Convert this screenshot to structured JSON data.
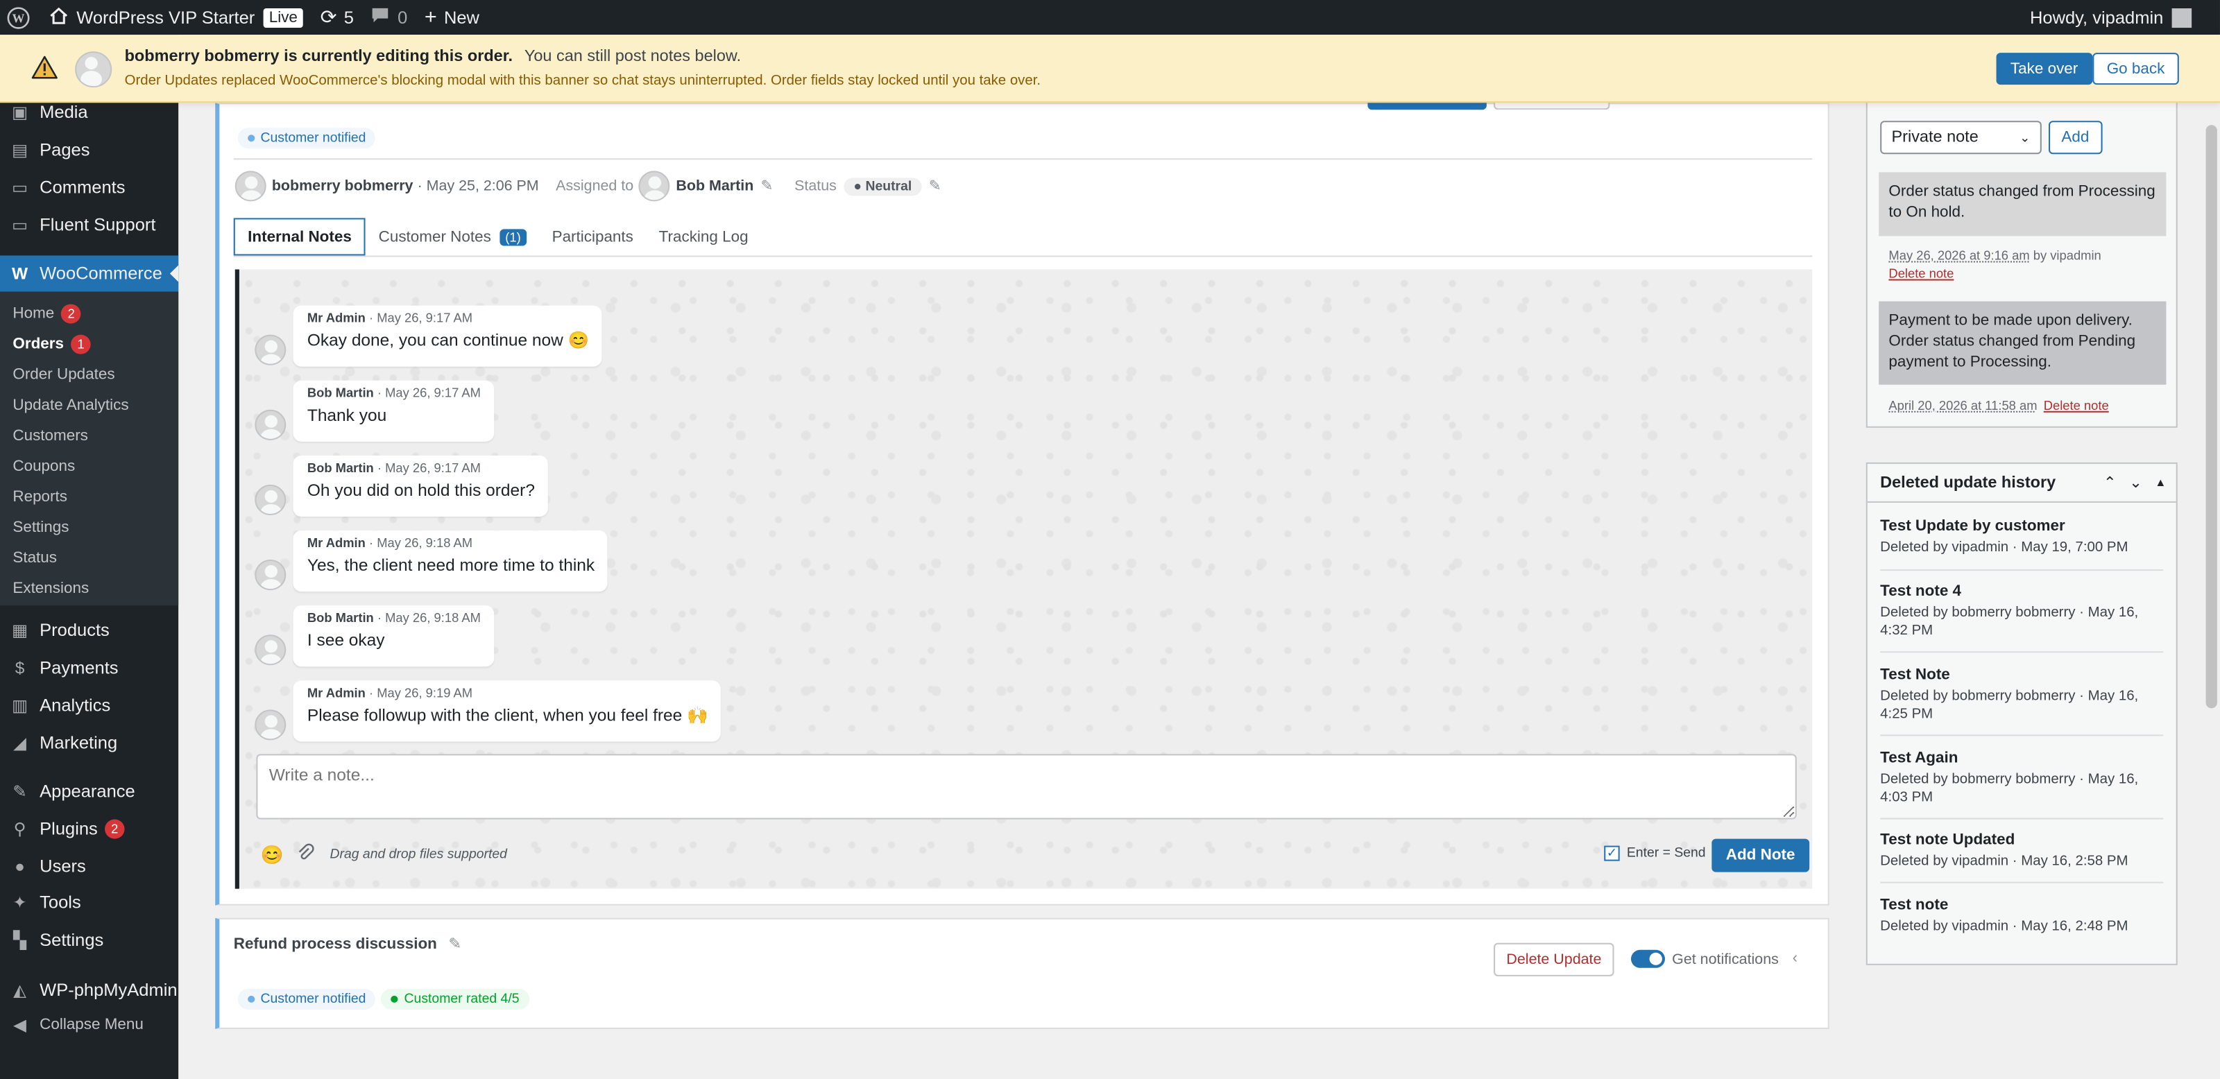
{
  "admin_bar": {
    "site_name": "WordPress VIP Starter",
    "live_label": "Live",
    "updates_count": "5",
    "comments_count": "0",
    "new_label": "New",
    "howdy": "Howdy, vipadmin"
  },
  "banner": {
    "headline": "bobmerry bobmerry is currently editing this order.",
    "headline_extra": "You can still post notes below.",
    "detail": "Order Updates replaced WooCommerce's blocking modal with this banner so chat stays uninterrupted. Order fields stay locked until you take over.",
    "take_over": "Take over",
    "go_back": "Go back"
  },
  "sidebar": {
    "top_items": [
      "Media",
      "Pages",
      "Comments",
      "Fluent Support"
    ],
    "woo_label": "WooCommerce",
    "woo_sub": [
      {
        "label": "Home",
        "count": "2"
      },
      {
        "label": "Orders",
        "count": "1"
      },
      {
        "label": "Order Updates"
      },
      {
        "label": "Update Analytics"
      },
      {
        "label": "Customers"
      },
      {
        "label": "Coupons"
      },
      {
        "label": "Reports"
      },
      {
        "label": "Settings"
      },
      {
        "label": "Status"
      },
      {
        "label": "Extensions"
      }
    ],
    "bottom_items": [
      {
        "label": "Products"
      },
      {
        "label": "Payments"
      },
      {
        "label": "Analytics"
      },
      {
        "label": "Marketing"
      },
      {
        "label": "Appearance"
      },
      {
        "label": "Plugins",
        "count": "2"
      },
      {
        "label": "Users"
      },
      {
        "label": "Tools"
      },
      {
        "label": "Settings"
      },
      {
        "label": "WP-phpMyAdmin"
      },
      {
        "label": "Collapse Menu"
      }
    ]
  },
  "update_card": {
    "customer_notified": "Customer notified",
    "author": "bobmerry bobmerry",
    "date": "· May 25, 2:06 PM",
    "assigned_label": "Assigned to",
    "assignee": "Bob Martin",
    "status_label": "Status",
    "status_value": "Neutral",
    "tabs": [
      {
        "label": "Internal Notes"
      },
      {
        "label": "Customer Notes",
        "count": "(1)"
      },
      {
        "label": "Participants"
      },
      {
        "label": "Tracking Log"
      }
    ],
    "messages": [
      {
        "author": "Mr Admin",
        "time": "· May 26, 9:17 AM",
        "text": "Okay done, you can continue now 😊"
      },
      {
        "author": "Bob Martin",
        "time": "· May 26, 9:17 AM",
        "text": "Thank you"
      },
      {
        "author": "Bob Martin",
        "time": "· May 26, 9:17 AM",
        "text": "Oh you did on hold this order?"
      },
      {
        "author": "Mr Admin",
        "time": "· May 26, 9:18 AM",
        "text": "Yes, the client need more time to think"
      },
      {
        "author": "Bob Martin",
        "time": "· May 26, 9:18 AM",
        "text": "I see okay"
      },
      {
        "author": "Mr Admin",
        "time": "· May 26, 9:19 AM",
        "text": "Please followup with the client, when you feel free 🙌"
      }
    ],
    "note_placeholder": "Write a note...",
    "drag_drop_hint": "Drag and drop files supported",
    "enter_send_label": "Enter = Send",
    "add_note": "Add Note"
  },
  "second_card": {
    "title": "Refund process discussion",
    "delete_update": "Delete Update",
    "get_notifications": "Get notifications",
    "customer_notified": "Customer notified",
    "customer_rated": "Customer rated 4/5"
  },
  "order_notes": {
    "note_type": "Private note",
    "add": "Add",
    "notes": [
      {
        "text": "Order status changed from Processing to On hold.",
        "meta": "May 26, 2026 at 9:16 am",
        "by": "by vipadmin",
        "delete": "Delete note"
      },
      {
        "text": "Payment to be made upon delivery. Order status changed from Pending payment to Processing.",
        "meta": "April 20, 2026 at 11:58 am",
        "delete": "Delete note"
      }
    ]
  },
  "deleted_history": {
    "title": "Deleted update history",
    "items": [
      {
        "title": "Test Update by customer",
        "sub": "Deleted by vipadmin · May 19, 7:00 PM"
      },
      {
        "title": "Test note 4",
        "sub": "Deleted by bobmerry bobmerry · May 16, 4:32 PM"
      },
      {
        "title": "Test Note",
        "sub": "Deleted by bobmerry bobmerry · May 16, 4:25 PM"
      },
      {
        "title": "Test Again",
        "sub": "Deleted by bobmerry bobmerry · May 16, 4:03 PM"
      },
      {
        "title": "Test note Updated",
        "sub": "Deleted by vipadmin · May 16, 2:58 PM"
      },
      {
        "title": "Test note",
        "sub": "Deleted by vipadmin · May 16, 2:48 PM"
      }
    ]
  },
  "colors": {
    "accent": "#2271b1",
    "admin_bar": "#1d2327",
    "banner_bg": "#fcf0c9",
    "danger": "#d63638"
  }
}
